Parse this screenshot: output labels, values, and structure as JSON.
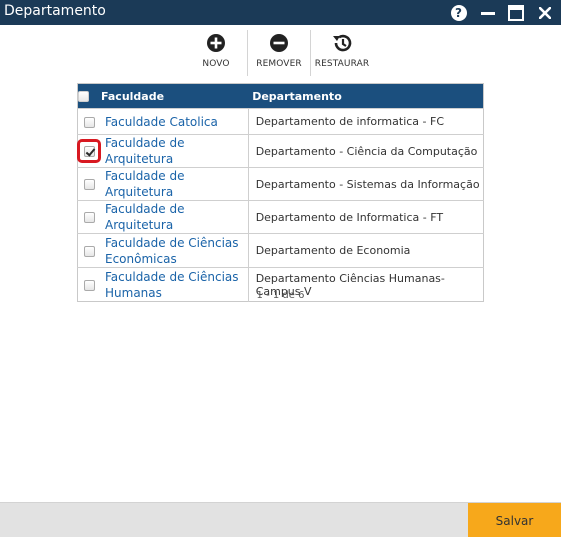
{
  "window": {
    "title": "Departamento",
    "help_label": "?"
  },
  "toolbar": {
    "new_label": "NOVO",
    "remove_label": "REMOVER",
    "restore_label": "RESTAURAR"
  },
  "table": {
    "headers": {
      "faculdade": "Faculdade",
      "departamento": "Departamento"
    },
    "rows": [
      {
        "faculdade": "Faculdade Catolica",
        "departamento": "Departamento de informatica - FC",
        "checked": false
      },
      {
        "faculdade": "Faculdade de Arquitetura",
        "departamento": "Departamento - Ciência da Computação",
        "checked": true
      },
      {
        "faculdade": "Faculdade de Arquitetura",
        "departamento": "Departamento - Sistemas da Informação",
        "checked": false
      },
      {
        "faculdade": "Faculdade de Arquitetura",
        "departamento": "Departamento de Informatica - FT",
        "checked": false
      },
      {
        "faculdade": "Faculdade de Ciências Econômicas",
        "departamento": "Departamento de Economia",
        "checked": false
      },
      {
        "faculdade": "Faculdade de Ciências Humanas",
        "departamento": "Departamento Ciências Humanas- Campus V",
        "checked": false
      }
    ]
  },
  "pager": {
    "text": "1 - 1 de 6"
  },
  "footer": {
    "save_label": "Salvar"
  },
  "colors": {
    "titlebar": "#1b3a57",
    "header": "#1b4f7e",
    "link": "#1a63a8",
    "save": "#f7a81b",
    "highlight": "#d81921"
  }
}
